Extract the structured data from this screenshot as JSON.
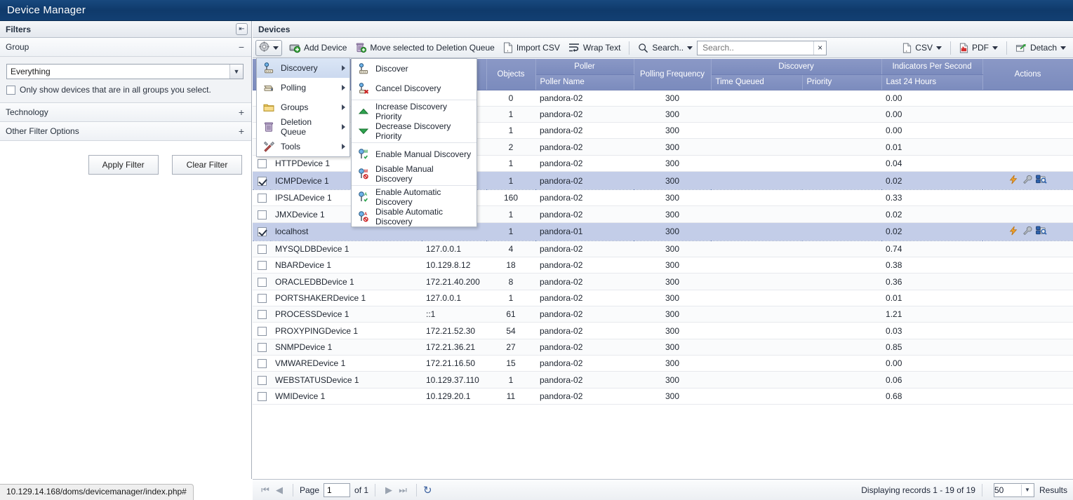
{
  "window": {
    "title": "Device Manager"
  },
  "filters": {
    "header": "Filters",
    "collapse_icon": "collapse-left-icon",
    "sections": [
      {
        "label": "Group",
        "sign": "−"
      },
      {
        "label": "Technology",
        "sign": "+"
      },
      {
        "label": "Other Filter Options",
        "sign": "+"
      }
    ],
    "group_select_value": "Everything",
    "group_checkbox_label": "Only show devices that are in all groups you select.",
    "group_checkbox_checked": false,
    "apply_button": "Apply Filter",
    "clear_button": "Clear Filter"
  },
  "devices": {
    "header": "Devices",
    "toolbar": {
      "gear_icon": "gear-icon",
      "items": [
        {
          "label": "Add Device",
          "icon": "add-device-icon"
        },
        {
          "label": "Move selected to Deletion Queue",
          "icon": "trash-add-icon"
        },
        {
          "label": "Import CSV",
          "icon": "csv-file-icon"
        },
        {
          "label": "Wrap Text",
          "icon": "wrap-text-icon"
        },
        {
          "label": "Search..",
          "icon": "search-icon"
        }
      ],
      "search_placeholder": "Search..",
      "search_value": "",
      "search_clear": "×",
      "right_items": [
        {
          "label": "CSV",
          "icon": "csv-file-icon"
        },
        {
          "label": "PDF",
          "icon": "pdf-file-icon"
        },
        {
          "label": "Detach",
          "icon": "detach-icon"
        }
      ]
    },
    "menu": {
      "level1": [
        {
          "label": "Discovery",
          "icon": "discovery-icon",
          "submenu": true,
          "highlighted": true
        },
        {
          "label": "Polling",
          "icon": "polling-icon",
          "submenu": true,
          "highlighted": false
        },
        {
          "label": "Groups",
          "icon": "folder-icon",
          "submenu": true,
          "highlighted": false
        },
        {
          "label": "Deletion Queue",
          "icon": "trash-icon",
          "submenu": true,
          "highlighted": false
        },
        {
          "label": "Tools",
          "icon": "tools-icon",
          "submenu": true,
          "highlighted": false
        }
      ],
      "level2": [
        {
          "label": "Discover",
          "icon": "discover-icon",
          "sep_after": false
        },
        {
          "label": "Cancel Discovery",
          "icon": "cancel-discovery-icon",
          "sep_after": true
        },
        {
          "label": "Increase Discovery Priority",
          "icon": "arrow-up-green-icon",
          "sep_after": false
        },
        {
          "label": "Decrease Discovery Priority",
          "icon": "arrow-down-green-icon",
          "sep_after": true
        },
        {
          "label": "Enable Manual Discovery",
          "icon": "enable-manual-discovery-icon",
          "sep_after": false
        },
        {
          "label": "Disable Manual Discovery",
          "icon": "disable-manual-discovery-icon",
          "sep_after": true
        },
        {
          "label": "Enable Automatic Discovery",
          "icon": "enable-auto-discovery-icon",
          "sep_after": false
        },
        {
          "label": "Disable Automatic Discovery",
          "icon": "disable-auto-discovery-icon",
          "sep_after": false
        }
      ]
    },
    "columns": {
      "group_headers": [
        {
          "label": "",
          "span": 1
        },
        {
          "label": "",
          "span": 1
        },
        {
          "label": "",
          "span": 1
        },
        {
          "label": "Objects",
          "span": 1
        },
        {
          "label": "Poller",
          "span": 1
        },
        {
          "label": "Polling Frequency",
          "span": 1
        },
        {
          "label": "Discovery",
          "span": 2
        },
        {
          "label": "Indicators Per Second",
          "span": 1
        },
        {
          "label": "Actions",
          "span": 1
        }
      ],
      "sub_headers": [
        {
          "label": ""
        },
        {
          "label": ""
        },
        {
          "label": ""
        },
        {
          "label": ""
        },
        {
          "label": "Poller Name"
        },
        {
          "label": ""
        },
        {
          "label": "Time Queued"
        },
        {
          "label": "Priority"
        },
        {
          "label": "Last 24 Hours"
        },
        {
          "label": ""
        }
      ]
    },
    "rows": [
      {
        "name": "",
        "ip": "",
        "objects": "0",
        "poller": "pandora-02",
        "freq": "300",
        "queued": "",
        "priority": "",
        "ips": "0.00",
        "selected": false,
        "checked": false,
        "actions": false,
        "hidden_by_menu": true
      },
      {
        "name": "",
        "ip": "",
        "objects": "1",
        "poller": "pandora-02",
        "freq": "300",
        "queued": "",
        "priority": "",
        "ips": "0.00",
        "selected": false,
        "checked": false,
        "actions": false,
        "hidden_by_menu": true
      },
      {
        "name": "",
        "ip": "",
        "objects": "1",
        "poller": "pandora-02",
        "freq": "300",
        "queued": "",
        "priority": "",
        "ips": "0.00",
        "selected": false,
        "checked": false,
        "actions": false,
        "hidden_by_menu": true
      },
      {
        "name": "",
        "ip": "",
        "objects": "2",
        "poller": "pandora-02",
        "freq": "300",
        "queued": "",
        "priority": "",
        "ips": "0.01",
        "selected": false,
        "checked": false,
        "actions": false,
        "hidden_by_menu": true
      },
      {
        "name": "HTTPDevice 1",
        "ip": "",
        "objects": "1",
        "poller": "pandora-02",
        "freq": "300",
        "queued": "",
        "priority": "",
        "ips": "0.04",
        "selected": false,
        "checked": false,
        "actions": false,
        "hidden_by_menu": false
      },
      {
        "name": "ICMPDevice 1",
        "ip": "",
        "objects": "1",
        "poller": "pandora-02",
        "freq": "300",
        "queued": "",
        "priority": "",
        "ips": "0.02",
        "selected": true,
        "checked": true,
        "actions": true,
        "hidden_by_menu": false
      },
      {
        "name": "IPSLADevice 1",
        "ip": "",
        "objects": "160",
        "poller": "pandora-02",
        "freq": "300",
        "queued": "",
        "priority": "",
        "ips": "0.33",
        "selected": false,
        "checked": false,
        "actions": false,
        "hidden_by_menu": false
      },
      {
        "name": "JMXDevice 1",
        "ip": "",
        "objects": "1",
        "poller": "pandora-02",
        "freq": "300",
        "queued": "",
        "priority": "",
        "ips": "0.02",
        "selected": false,
        "checked": false,
        "actions": false,
        "hidden_by_menu": false
      },
      {
        "name": "localhost",
        "ip": "",
        "objects": "1",
        "poller": "pandora-01",
        "freq": "300",
        "queued": "",
        "priority": "",
        "ips": "0.02",
        "selected": true,
        "checked": true,
        "actions": true,
        "hidden_by_menu": false
      },
      {
        "name": "MYSQLDBDevice 1",
        "ip": "127.0.0.1",
        "objects": "4",
        "poller": "pandora-02",
        "freq": "300",
        "queued": "",
        "priority": "",
        "ips": "0.74",
        "selected": false,
        "checked": false,
        "actions": false,
        "hidden_by_menu": false
      },
      {
        "name": "NBARDevice 1",
        "ip": "10.129.8.12",
        "objects": "18",
        "poller": "pandora-02",
        "freq": "300",
        "queued": "",
        "priority": "",
        "ips": "0.38",
        "selected": false,
        "checked": false,
        "actions": false,
        "hidden_by_menu": false
      },
      {
        "name": "ORACLEDBDevice 1",
        "ip": "172.21.40.200",
        "objects": "8",
        "poller": "pandora-02",
        "freq": "300",
        "queued": "",
        "priority": "",
        "ips": "0.36",
        "selected": false,
        "checked": false,
        "actions": false,
        "hidden_by_menu": false
      },
      {
        "name": "PORTSHAKERDevice 1",
        "ip": "127.0.0.1",
        "objects": "1",
        "poller": "pandora-02",
        "freq": "300",
        "queued": "",
        "priority": "",
        "ips": "0.01",
        "selected": false,
        "checked": false,
        "actions": false,
        "hidden_by_menu": false
      },
      {
        "name": "PROCESSDevice 1",
        "ip": "::1",
        "objects": "61",
        "poller": "pandora-02",
        "freq": "300",
        "queued": "",
        "priority": "",
        "ips": "1.21",
        "selected": false,
        "checked": false,
        "actions": false,
        "hidden_by_menu": false
      },
      {
        "name": "PROXYPINGDevice 1",
        "ip": "172.21.52.30",
        "objects": "54",
        "poller": "pandora-02",
        "freq": "300",
        "queued": "",
        "priority": "",
        "ips": "0.03",
        "selected": false,
        "checked": false,
        "actions": false,
        "hidden_by_menu": false
      },
      {
        "name": "SNMPDevice 1",
        "ip": "172.21.36.21",
        "objects": "27",
        "poller": "pandora-02",
        "freq": "300",
        "queued": "",
        "priority": "",
        "ips": "0.85",
        "selected": false,
        "checked": false,
        "actions": false,
        "hidden_by_menu": false
      },
      {
        "name": "VMWAREDevice 1",
        "ip": "172.21.16.50",
        "objects": "15",
        "poller": "pandora-02",
        "freq": "300",
        "queued": "",
        "priority": "",
        "ips": "0.00",
        "selected": false,
        "checked": false,
        "actions": false,
        "hidden_by_menu": false
      },
      {
        "name": "WEBSTATUSDevice 1",
        "ip": "10.129.37.110",
        "objects": "1",
        "poller": "pandora-02",
        "freq": "300",
        "queued": "",
        "priority": "",
        "ips": "0.06",
        "selected": false,
        "checked": false,
        "actions": false,
        "hidden_by_menu": false
      },
      {
        "name": "WMIDevice 1",
        "ip": "10.129.20.1",
        "objects": "11",
        "poller": "pandora-02",
        "freq": "300",
        "queued": "",
        "priority": "",
        "ips": "0.68",
        "selected": false,
        "checked": false,
        "actions": false,
        "hidden_by_menu": false
      }
    ],
    "row_action_icons": [
      "lightning-icon",
      "wrench-icon",
      "device-search-icon"
    ]
  },
  "footer": {
    "first_page_icon": "first-page-icon",
    "prev_page_icon": "prev-page-icon",
    "page_label": "Page",
    "page_value": "1",
    "of_label": "of 1",
    "next_page_icon": "next-page-icon",
    "last_page_icon": "last-page-icon",
    "refresh_icon": "refresh-icon",
    "records_text": "Displaying records 1 - 19 of 19",
    "results_count": "50",
    "results_label": "Results"
  },
  "statusbar": {
    "url": "10.129.14.168/doms/devicemanager/index.php#"
  },
  "colors": {
    "title_bar": "#123f72",
    "header_row": "#7b8bbd",
    "selected_row": "#c3cde8",
    "accent_blue": "#3a5f9e"
  }
}
